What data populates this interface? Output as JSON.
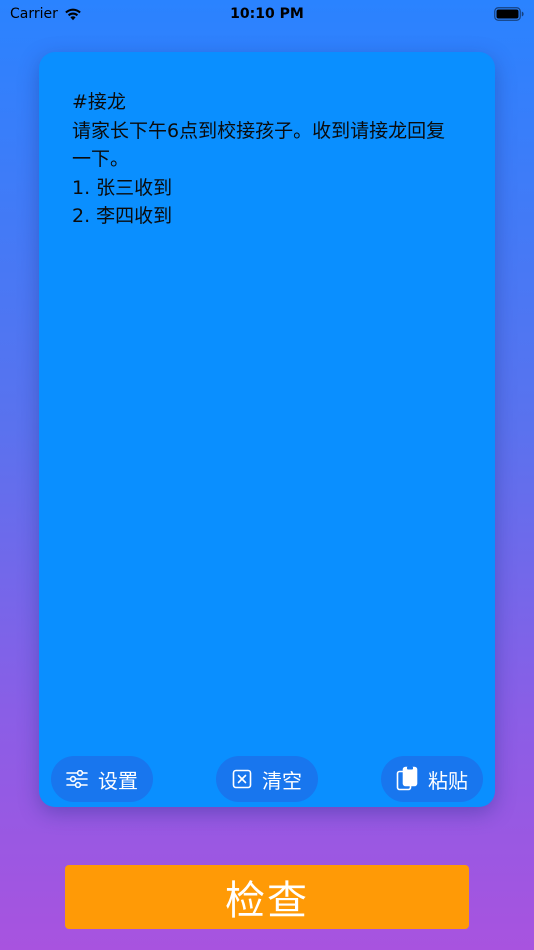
{
  "status_bar": {
    "carrier": "Carrier",
    "time": "10:10 PM",
    "icons": [
      "wifi-icon",
      "battery-icon"
    ]
  },
  "note": {
    "text": "#接龙\n请家长下午6点到校接孩子。收到请接龙回复一下。\n1. 张三收到\n2. 李四收到"
  },
  "card_actions": {
    "settings": {
      "label": "设置",
      "icon": "sliders-icon"
    },
    "clear": {
      "label": "清空",
      "icon": "clear-box-icon"
    },
    "paste": {
      "label": "粘贴",
      "icon": "clipboard-icon"
    }
  },
  "check_button": {
    "label": "检查"
  },
  "colors": {
    "card": "#0a8fff",
    "action_button": "#1876ee",
    "check_button": "#ff9a06",
    "gradient_top": "#2a83ff",
    "gradient_bottom": "#a853df"
  }
}
